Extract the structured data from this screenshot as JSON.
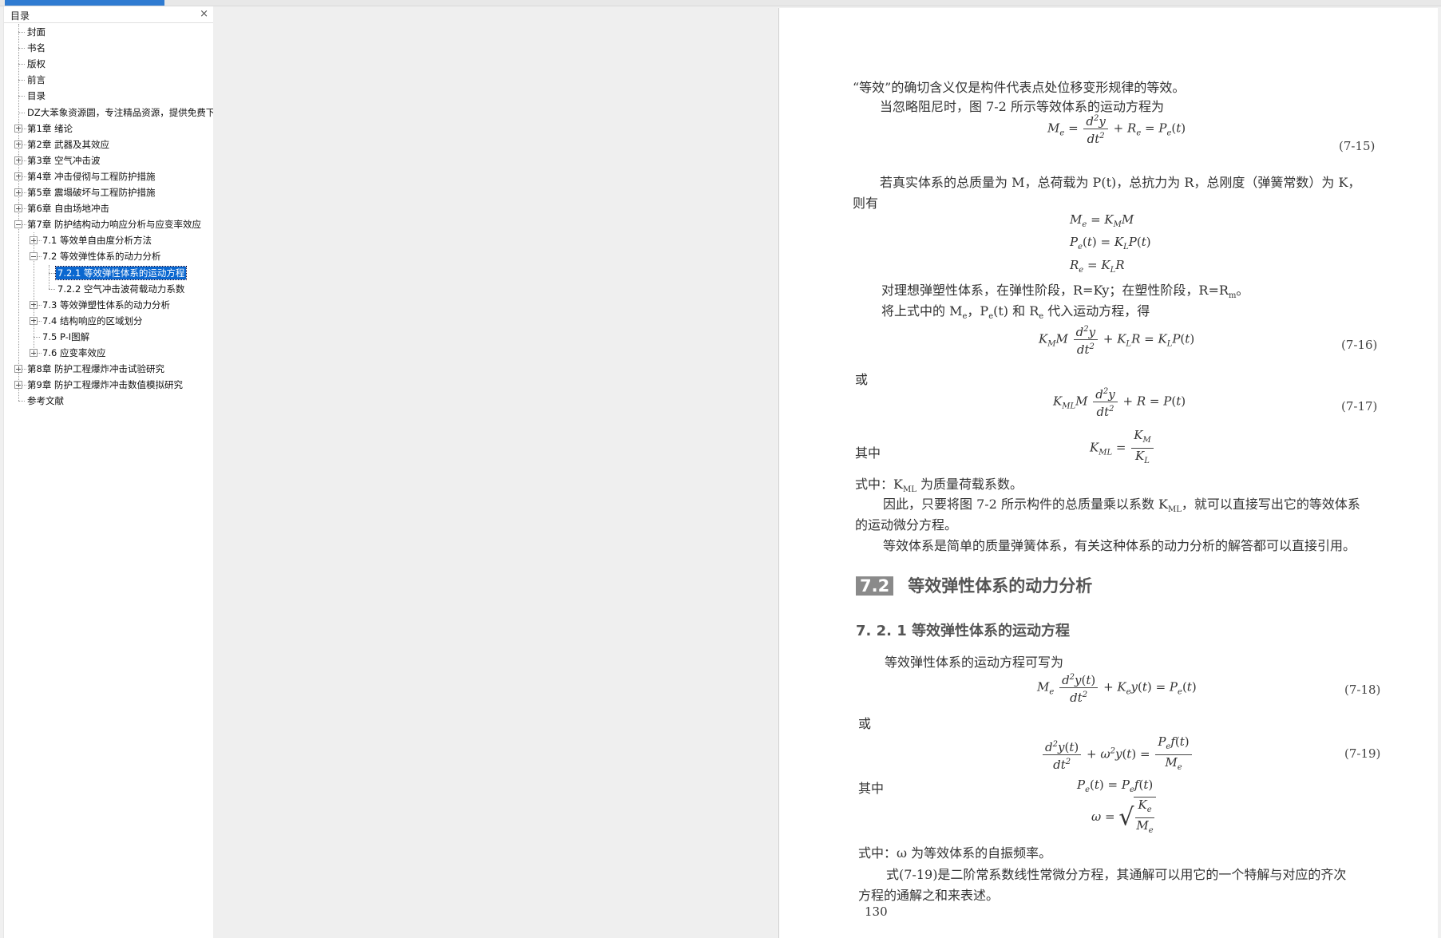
{
  "topbar": {
    "accent": "#2f7bd1"
  },
  "sidebar": {
    "title": "目录",
    "close_glyph": "×",
    "items": [
      {
        "label": "封面",
        "level": 0,
        "toggle": "none"
      },
      {
        "label": "书名",
        "level": 0,
        "toggle": "none"
      },
      {
        "label": "版权",
        "level": 0,
        "toggle": "none"
      },
      {
        "label": "前言",
        "level": 0,
        "toggle": "none"
      },
      {
        "label": "目录",
        "level": 0,
        "toggle": "none"
      },
      {
        "label": "DZ大苯象资源圆，专注精品资源，提供免费下",
        "level": 0,
        "toggle": "none"
      },
      {
        "label": "第1章 绪论",
        "level": 0,
        "toggle": "plus"
      },
      {
        "label": "第2章 武器及其效应",
        "level": 0,
        "toggle": "plus"
      },
      {
        "label": "第3章 空气冲击波",
        "level": 0,
        "toggle": "plus"
      },
      {
        "label": "第4章 冲击侵彻与工程防护措施",
        "level": 0,
        "toggle": "plus"
      },
      {
        "label": "第5章 震塌破坏与工程防护措施",
        "level": 0,
        "toggle": "plus"
      },
      {
        "label": "第6章 自由场地冲击",
        "level": 0,
        "toggle": "plus"
      },
      {
        "label": "第7章 防护结构动力响应分析与应变率效应",
        "level": 0,
        "toggle": "minus"
      },
      {
        "label": "7.1 等效单自由度分析方法",
        "level": 1,
        "toggle": "plus"
      },
      {
        "label": "7.2 等效弹性体系的动力分析",
        "level": 1,
        "toggle": "minus"
      },
      {
        "label": "7.2.1 等效弹性体系的运动方程",
        "level": 2,
        "toggle": "none",
        "selected": true
      },
      {
        "label": "7.2.2 空气冲击波荷载动力系数",
        "level": 2,
        "toggle": "none"
      },
      {
        "label": "7.3 等效弹塑性体系的动力分析",
        "level": 1,
        "toggle": "plus"
      },
      {
        "label": "7.4 结构响应的区域划分",
        "level": 1,
        "toggle": "plus"
      },
      {
        "label": "7.5 P-I图解",
        "level": 1,
        "toggle": "none"
      },
      {
        "label": "7.6 应变率效应",
        "level": 1,
        "toggle": "plus"
      },
      {
        "label": "第8章 防护工程爆炸冲击试验研究",
        "level": 0,
        "toggle": "plus"
      },
      {
        "label": "第9章 防护工程爆炸冲击数值模拟研究",
        "level": 0,
        "toggle": "plus"
      },
      {
        "label": "参考文献",
        "level": 0,
        "toggle": "none"
      }
    ]
  },
  "document": {
    "p1": "“等效”的确切含义仅是构件代表点处位移变形规律的等效。",
    "p2": "当忽略阻尼时，图 7-2 所示等效体系的运动方程为",
    "eq15": "(7-15)",
    "p3": "若真实体系的总质量为 M，总荷载为 P(t)，总抗力为 R，总刚度（弹簧常数）为 K，",
    "p3b": "则有",
    "p4": "对理想弹塑性体系，在弹性阶段，R=Ky；在塑性阶段，R=R",
    "p4_sub": "m",
    "p4_end": "。",
    "p5": "将上式中的 M",
    "p5_mid": "，P",
    "p5_mid2": "(t) 和 R",
    "p5_end": " 代入运动方程，得",
    "eq16": "(7-16)",
    "huo1": "或",
    "eq17": "(7-17)",
    "qizhong1": "其中",
    "p6": "式中：K",
    "p6_sub": "ML",
    "p6_end": " 为质量荷载系数。",
    "p7": "因此，只要将图 7-2 所示构件的总质量乘以系数 K",
    "p7_sub": "ML",
    "p7_end": "，就可以直接写出它的等效体系",
    "p7b": "的运动微分方程。",
    "p8": "等效体系是简单的质量弹簧体系，有关这种体系的动力分析的解答都可以直接引用。",
    "sec_num": "7.2",
    "sec_title": "等效弹性体系的动力分析",
    "subsec": "7. 2. 1    等效弹性体系的运动方程",
    "p9": "等效弹性体系的运动方程可写为",
    "eq18": "(7-18)",
    "huo2": "或",
    "eq19": "(7-19)",
    "qizhong2": "其中",
    "p10": "式中：ω 为等效体系的自振频率。",
    "p11": "式(7-19)是二阶常系数线性常微分方程，其通解可以用它的一个特解与对应的齐次",
    "p11b": "方程的通解之和来表述。",
    "page_number": "130"
  }
}
